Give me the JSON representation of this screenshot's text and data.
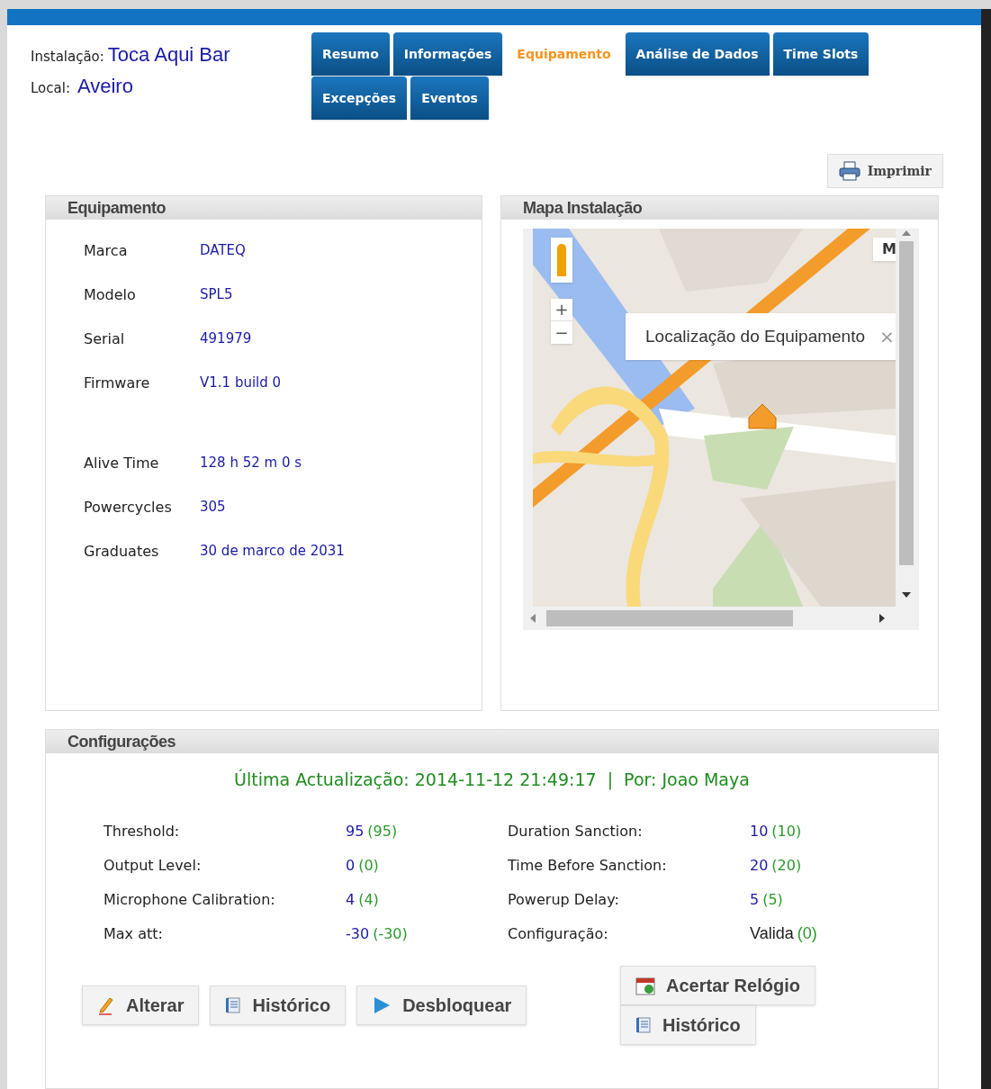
{
  "header": {
    "installation": {
      "label": "Instalação:",
      "value": "Toca Aqui Bar"
    },
    "location": {
      "label": "Local:",
      "value": "Aveiro"
    }
  },
  "tabs": [
    {
      "label": "Resumo",
      "selected": false
    },
    {
      "label": "Informações",
      "selected": false
    },
    {
      "label": "Equipamento",
      "selected": true
    },
    {
      "label": "Análise de Dados",
      "selected": false
    },
    {
      "label": "Time Slots",
      "selected": false
    },
    {
      "label": "Excepções",
      "selected": false
    },
    {
      "label": "Eventos",
      "selected": false
    }
  ],
  "print_button": "Imprimir",
  "equipment": {
    "title": "Equipamento",
    "fields": [
      {
        "label": "Marca",
        "value": "DATEQ"
      },
      {
        "label": "Modelo",
        "value": "SPL5"
      },
      {
        "label": "Serial",
        "value": "491979"
      },
      {
        "label": "Firmware",
        "value": "V1.1 build 0"
      },
      {
        "label": "Alive Time",
        "value": "128 h 52 m 0 s"
      },
      {
        "label": "Powercycles",
        "value": "305"
      },
      {
        "label": "Graduates",
        "value": "30 de marco de 2031"
      }
    ]
  },
  "map": {
    "title": "Mapa Instalação",
    "popup": "Localização do Equipamento",
    "zoom_in": "+",
    "zoom_out": "−",
    "close": "×",
    "map_type": "M"
  },
  "configuration": {
    "title": "Configurações",
    "last_update": "Última Actualização: 2014-11-12 21:49:17  |  Por: Joao Maya",
    "left": [
      {
        "label": "Threshold:",
        "value": "95",
        "reference": "(95)",
        "kind": "number"
      },
      {
        "label": "Output Level:",
        "value": "0",
        "reference": "(0)",
        "kind": "number"
      },
      {
        "label": "Microphone Calibration:",
        "value": "4",
        "reference": "(4)",
        "kind": "number"
      },
      {
        "label": "Max att:",
        "value": "-30",
        "reference": "(-30)",
        "kind": "number"
      }
    ],
    "right": [
      {
        "label": "Duration Sanction:",
        "value": "10",
        "reference": "(10)",
        "kind": "number"
      },
      {
        "label": "Time Before Sanction:",
        "value": "20",
        "reference": "(20)",
        "kind": "number"
      },
      {
        "label": "Powerup Delay:",
        "value": "5",
        "reference": "(5)",
        "kind": "number"
      },
      {
        "label": "Configuração:",
        "value": "Valida",
        "reference": "(0)",
        "kind": "status"
      }
    ],
    "buttons": [
      {
        "label": "Alterar",
        "kind": "edit"
      },
      {
        "label": "Histórico",
        "kind": "history"
      },
      {
        "label": "Desbloquear",
        "kind": "unlock"
      }
    ],
    "side_buttons": [
      {
        "label": "Acertar Relógio",
        "kind": "clock"
      },
      {
        "label": "Histórico",
        "kind": "history"
      }
    ]
  }
}
